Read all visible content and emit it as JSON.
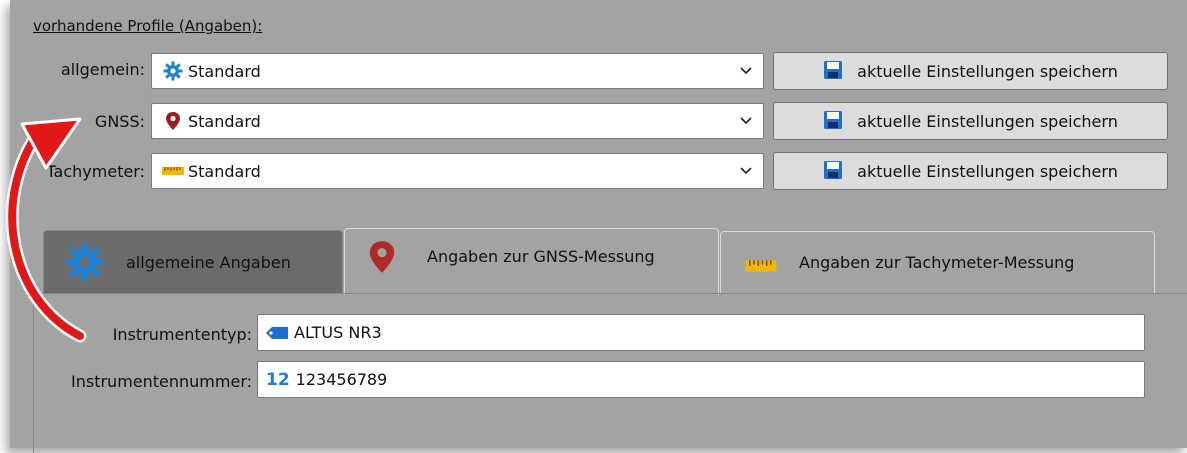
{
  "profiles": {
    "title": "vorhandene Profile (Angaben):",
    "rows": [
      {
        "label": "allgemein:",
        "value": "Standard",
        "icon": "gear-icon",
        "save_label": "aktuelle Einstellungen speichern"
      },
      {
        "label": "GNSS:",
        "value": "Standard",
        "icon": "map-pin-icon",
        "save_label": "aktuelle Einstellungen speichern"
      },
      {
        "label": "Tachymeter:",
        "value": "Standard",
        "icon": "ruler-icon",
        "save_label": "aktuelle Einstellungen speichern"
      }
    ]
  },
  "tabs": [
    {
      "label": "allgemeine Angaben",
      "icon": "gear-icon",
      "selected": false
    },
    {
      "label": "Angaben zur GNSS-Messung",
      "icon": "map-pin-icon",
      "selected": true
    },
    {
      "label": "Angaben zur Tachymeter-Messung",
      "icon": "ruler-icon",
      "selected": false
    }
  ],
  "gnss_form": {
    "instrument_type_label": "Instrumententyp:",
    "instrument_type_value": "ALTUS NR3",
    "instrument_number_label": "Instrumentennummer:",
    "instrument_number_prefix": "12",
    "instrument_number_value": "123456789"
  },
  "colors": {
    "panel_bg": "#a3a3a3",
    "accent_blue": "#1e7fd6",
    "pin_red": "#b02a2a",
    "ruler_yellow": "#f2b705",
    "annotation_arrow": "#e01818"
  }
}
